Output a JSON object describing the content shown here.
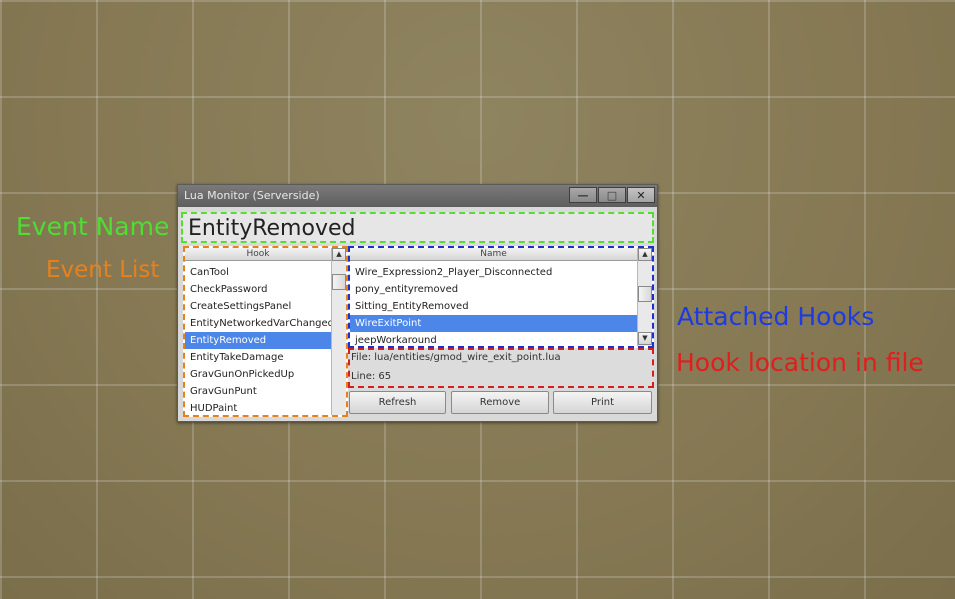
{
  "annotations": {
    "event_name": "Event Name",
    "event_list": "Event List",
    "attached_hooks": "Attached Hooks",
    "hook_location": "Hook location in file"
  },
  "window": {
    "title": "Lua Monitor (Serverside)",
    "minimize_glyph": "—",
    "maximize_glyph": "□",
    "close_glyph": "✕"
  },
  "event_name": "EntityRemoved",
  "hook_list": {
    "header": "Hook",
    "items": [
      "CanTool",
      "CheckPassword",
      "CreateSettingsPanel",
      "EntityNetworkedVarChanged",
      "EntityRemoved",
      "EntityTakeDamage",
      "GravGunOnPickedUp",
      "GravGunPunt",
      "HUDPaint"
    ],
    "selected_index": 4
  },
  "name_list": {
    "header": "Name",
    "items": [
      "Wire_Expression2_Player_Disconnected",
      "pony_entityremoved",
      "Sitting_EntityRemoved",
      "WireExitPoint",
      "jeepWorkaround"
    ],
    "selected_index": 3
  },
  "location": {
    "file": "File: lua/entities/gmod_wire_exit_point.lua",
    "line": "Line: 65"
  },
  "buttons": {
    "refresh": "Refresh",
    "remove": "Remove",
    "print": "Print"
  },
  "icons": {
    "scroll_up": "▲",
    "scroll_down": "▼"
  }
}
